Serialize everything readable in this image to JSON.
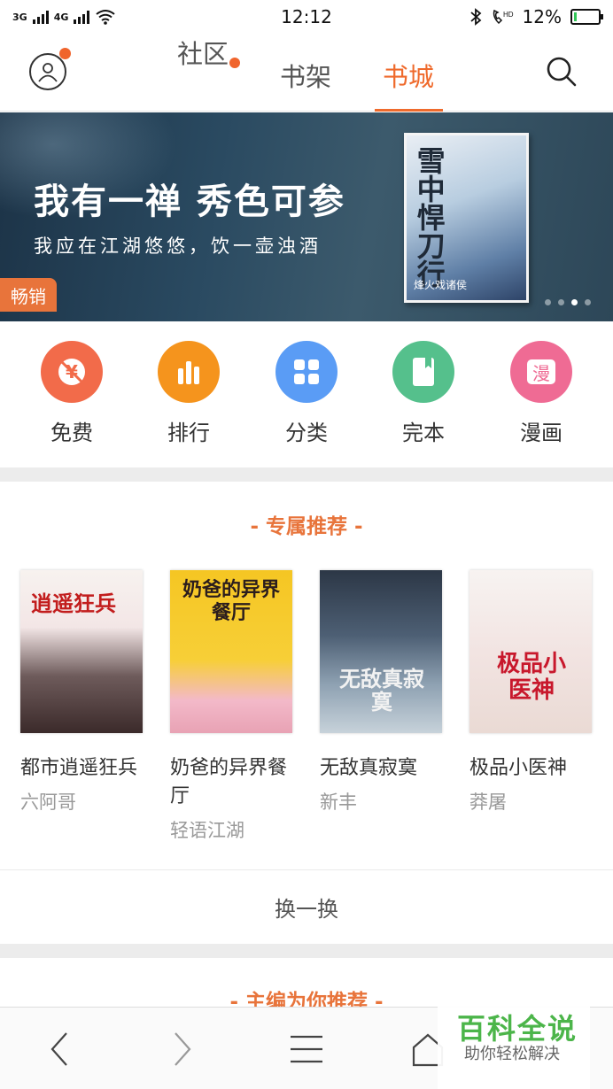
{
  "status_bar": {
    "net1": "3G",
    "net2": "4G",
    "time": "12:12",
    "battery_pct": "12%",
    "battery_level": 0.12,
    "icons": [
      "signal-icon",
      "signal-icon",
      "wifi-icon",
      "bluetooth-icon",
      "hd-call-icon",
      "battery-icon"
    ]
  },
  "header": {
    "tabs": [
      {
        "label": "社区",
        "has_badge": true
      },
      {
        "label": "书架",
        "has_badge": false
      },
      {
        "label": "书城",
        "active": true
      }
    ],
    "accent": "#ef6a2c"
  },
  "banner": {
    "title": "我有一禅 秀色可参",
    "subtitle": "我应在江湖悠悠，饮一壶浊酒",
    "tag": "畅销",
    "cover_title": "雪中悍刀行",
    "cover_author": "烽火戏诸侯",
    "active_dot": 3,
    "dot_count": 4
  },
  "categories": [
    {
      "label": "免费",
      "icon": "yuan-free-icon",
      "color": "#f26b4a"
    },
    {
      "label": "排行",
      "icon": "bar-chart-icon",
      "color": "#f5941d"
    },
    {
      "label": "分类",
      "icon": "grid-icon",
      "color": "#5a9cf5"
    },
    {
      "label": "完本",
      "icon": "book-icon",
      "color": "#55c08c"
    },
    {
      "label": "漫画",
      "icon": "comic-icon",
      "color": "#ef6b94"
    }
  ],
  "exclusive": {
    "title": "- 专属推荐 -",
    "books": [
      {
        "name": "都市逍遥狂兵",
        "author": "六阿哥",
        "cover_text": "逍遥狂兵"
      },
      {
        "name": "奶爸的异界餐厅",
        "author": "轻语江湖",
        "cover_text": "奶爸的异界餐厅"
      },
      {
        "name": "无敌真寂寞",
        "author": "新丰",
        "cover_text": "无敌真寂寞"
      },
      {
        "name": "极品小医神",
        "author": "莽屠",
        "cover_text": "极品小医神"
      }
    ],
    "refresh_label": "换一换"
  },
  "editor": {
    "title": "- 主编为你推荐 -"
  },
  "bottom_nav": {
    "icons": [
      "back-icon",
      "forward-icon",
      "menu-icon",
      "home-icon"
    ]
  },
  "watermark": {
    "title": "百科全说",
    "subtitle": "助你轻松解决"
  }
}
